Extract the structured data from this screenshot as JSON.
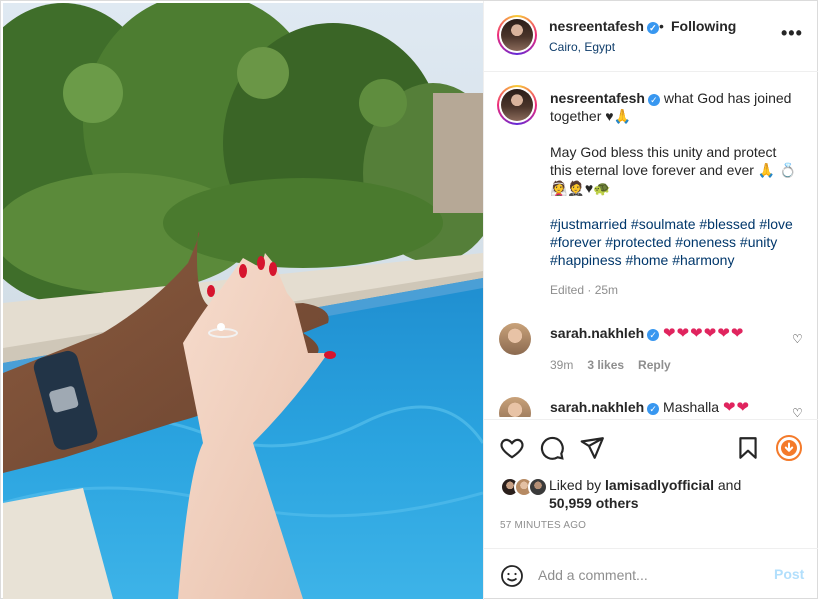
{
  "header": {
    "username": "nesreentafesh",
    "separator": "•",
    "follow_label": "Following",
    "location": "Cairo, Egypt",
    "more_label": "•••"
  },
  "caption": {
    "username": "nesreentafesh",
    "line1": "what God has joined together ♥🙏",
    "line2": "May God bless this unity and protect this eternal love forever and ever 🙏 💍👰🤵♥🐢",
    "hashtags": "#justmarried #soulmate #blessed #love #forever #protected #oneness #unity #happiness #home #harmony",
    "meta": "Edited · 25m"
  },
  "comments": [
    {
      "username": "sarah.nakhleh",
      "text": "",
      "hearts": "❤❤❤❤❤❤",
      "time": "39m",
      "likes": "3 likes",
      "reply": "Reply"
    },
    {
      "username": "sarah.nakhleh",
      "text": "Mashalla",
      "hearts": "❤❤"
    }
  ],
  "likes": {
    "prefix": "Liked by",
    "liker": "lamisadlyofficial",
    "connector": "and",
    "others": "50,959 others"
  },
  "timestamp": "57 MINUTES AGO",
  "add_comment": {
    "placeholder": "Add a comment...",
    "post_label": "Post"
  },
  "colors": {
    "verified": "#3897f0",
    "hashtag": "#00376b",
    "heart": "#e0245e",
    "post_disabled": "#b2dffc",
    "reel_accent": "#f47a2a"
  },
  "icons": {
    "like": "heart-icon",
    "comment": "comment-icon",
    "share": "paper-plane-icon",
    "save": "bookmark-icon",
    "extra": "reel-badge-icon",
    "emoji": "emoji-icon"
  }
}
